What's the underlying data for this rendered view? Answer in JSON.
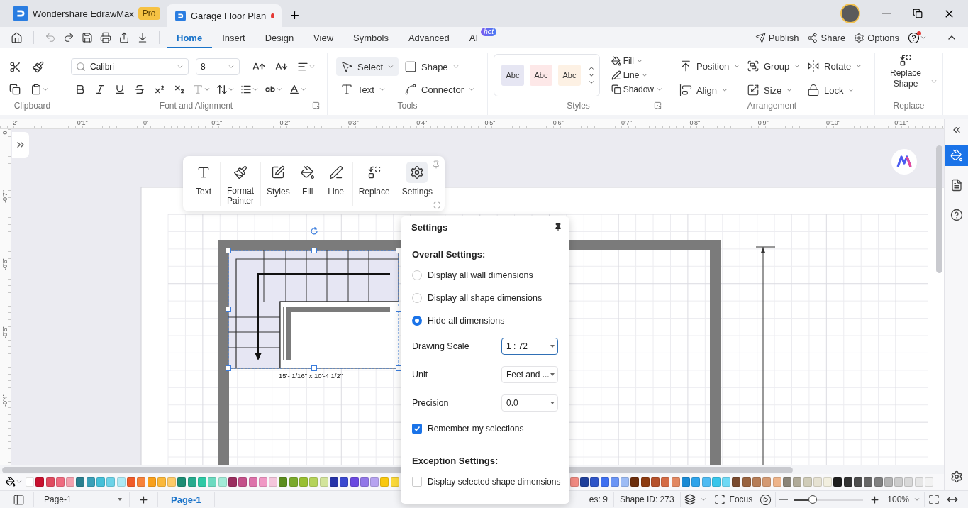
{
  "app_tab": {
    "name": "Wondershare EdrawMax",
    "badge": "Pro"
  },
  "doc_tab": {
    "title": "Garage Floor Plan",
    "unsaved": true,
    "selected": true
  },
  "quick_access": [
    {
      "kind": "undo",
      "disabled": true
    },
    {
      "kind": "redo",
      "disabled": false
    },
    {
      "kind": "save",
      "disabled": false
    },
    {
      "kind": "print",
      "disabled": false
    },
    {
      "kind": "export",
      "disabled": false
    },
    {
      "kind": "more",
      "disabled": false
    }
  ],
  "menu_tabs": [
    {
      "label": "Home",
      "selected": true
    },
    {
      "label": "Insert",
      "selected": false
    },
    {
      "label": "Design",
      "selected": false
    },
    {
      "label": "View",
      "selected": false
    },
    {
      "label": "Symbols",
      "selected": false
    },
    {
      "label": "Advanced",
      "selected": false
    },
    {
      "label": "AI",
      "selected": false,
      "badge": "hot"
    }
  ],
  "menu_actions": [
    {
      "kind": "publish",
      "label": "Publish"
    },
    {
      "kind": "share",
      "label": "Share"
    },
    {
      "kind": "options",
      "label": "Options"
    }
  ],
  "ribbon": {
    "clipboard": {
      "title": "Clipboard"
    },
    "font": {
      "title": "Font and Alignment",
      "family": "Calibri",
      "size": "8",
      "format_buttons": [
        {
          "kind": "bold",
          "disabled": false
        },
        {
          "kind": "italic",
          "disabled": false
        },
        {
          "kind": "underline",
          "disabled": false
        },
        {
          "kind": "strike",
          "disabled": false
        },
        {
          "kind": "superscript",
          "disabled": false
        },
        {
          "kind": "subscript",
          "disabled": false
        },
        {
          "kind": "text-effect",
          "disabled": true
        },
        {
          "kind": "spacing",
          "disabled": false
        },
        {
          "kind": "list",
          "disabled": false
        },
        {
          "kind": "case",
          "disabled": false
        },
        {
          "kind": "font-color",
          "disabled": false
        }
      ]
    },
    "tools": {
      "title": "Tools",
      "items": [
        {
          "kind": "select",
          "label": "Select",
          "selected": true
        },
        {
          "kind": "shape",
          "label": "Shape",
          "selected": false
        },
        {
          "kind": "text",
          "label": "Text",
          "selected": false
        },
        {
          "kind": "connector",
          "label": "Connector",
          "selected": false
        }
      ]
    },
    "styles": {
      "title": "Styles",
      "swatches": [
        {
          "label": "Abc",
          "color": "#e6e6f3"
        },
        {
          "label": "Abc",
          "color": "#fde8e8"
        },
        {
          "label": "Abc",
          "color": "#fdf1e4"
        }
      ],
      "items": [
        {
          "kind": "fill",
          "label": "Fill"
        },
        {
          "kind": "line",
          "label": "Line"
        },
        {
          "kind": "shadow",
          "label": "Shadow"
        }
      ]
    },
    "arrangement": {
      "title": "Arrangement",
      "items": [
        {
          "kind": "position",
          "label": "Position"
        },
        {
          "kind": "group",
          "label": "Group"
        },
        {
          "kind": "rotate",
          "label": "Rotate"
        },
        {
          "kind": "align",
          "label": "Align"
        },
        {
          "kind": "size",
          "label": "Size"
        },
        {
          "kind": "lock",
          "label": "Lock"
        }
      ]
    },
    "replace": {
      "title": "Replace",
      "label": "Replace Shape"
    }
  },
  "ruler": {
    "horizontal": [
      "2\"",
      "-0'1\"",
      "0'",
      "0'1\"",
      "0'2\"",
      "0'3\"",
      "0'4\"",
      "0'5\"",
      "0'6\"",
      "0'7\"",
      "0'8\"",
      "0'9\"",
      "0'10\"",
      "0'11\""
    ],
    "vertical": [
      "0",
      "-0'7\"",
      "-0'6\"",
      "-0'5\"",
      "-0'4\""
    ]
  },
  "floating_toolbar": {
    "groups": [
      {
        "items": [
          {
            "kind": "text",
            "label": "Text",
            "selected": false
          }
        ]
      },
      {
        "items": [
          {
            "kind": "painter",
            "label": "Format Painter",
            "selected": false
          }
        ]
      },
      {
        "items": [
          {
            "kind": "styles",
            "label": "Styles",
            "selected": false
          },
          {
            "kind": "fill",
            "label": "Fill",
            "selected": false
          },
          {
            "kind": "line",
            "label": "Line",
            "selected": false
          }
        ]
      },
      {
        "items": [
          {
            "kind": "replace",
            "label": "Replace",
            "selected": false
          }
        ]
      },
      {
        "items": [
          {
            "kind": "settings",
            "label": "Settings",
            "selected": true
          }
        ]
      }
    ]
  },
  "drawing": {
    "dimension_label": "15'- 1/16\" x 10'-4 1/2\""
  },
  "settings_panel": {
    "title": "Settings",
    "overall_heading": "Overall Settings:",
    "options": [
      {
        "label": "Display all wall dimensions",
        "selected": false
      },
      {
        "label": "Display all shape dimensions",
        "selected": false
      },
      {
        "label": "Hide all dimensions",
        "selected": true
      }
    ],
    "fields": [
      {
        "label": "Drawing Scale",
        "value": "1 : 72",
        "focused": true
      },
      {
        "label": "Unit",
        "value": "Feet and ...",
        "focused": false
      },
      {
        "label": "Precision",
        "value": "0.0",
        "focused": false
      }
    ],
    "remember": {
      "label": "Remember my selections",
      "checked": true
    },
    "exception_heading": "Exception Settings:",
    "exception": {
      "label": "Display selected shape dimensions",
      "checked": false
    }
  },
  "palette_left": [
    {
      "color": "#ffffff"
    },
    {
      "color": "#c8102e"
    },
    {
      "color": "#e04a5f"
    },
    {
      "color": "#ef6b80"
    },
    {
      "color": "#f3a0ae"
    },
    {
      "color": "#2a7f8f"
    },
    {
      "color": "#3aa0b8"
    },
    {
      "color": "#45c0d8"
    },
    {
      "color": "#6dd3e8"
    },
    {
      "color": "#aeeaf5"
    },
    {
      "color": "#f05a28"
    },
    {
      "color": "#f7823a"
    },
    {
      "color": "#f9a01b"
    },
    {
      "color": "#fbb83a"
    },
    {
      "color": "#fdca68"
    },
    {
      "color": "#1c8c74"
    },
    {
      "color": "#27ab8e"
    },
    {
      "color": "#2ec9a5"
    },
    {
      "color": "#6cdac0"
    },
    {
      "color": "#a3ebd8"
    },
    {
      "color": "#9a2d5f"
    },
    {
      "color": "#c4508a"
    },
    {
      "color": "#dd72aa"
    },
    {
      "color": "#f097c4"
    },
    {
      "color": "#f4c6dc"
    },
    {
      "color": "#5b8c1e"
    },
    {
      "color": "#7aaa2c"
    },
    {
      "color": "#98bf31"
    },
    {
      "color": "#b5d35a"
    },
    {
      "color": "#d3e49b"
    },
    {
      "color": "#2633a8"
    },
    {
      "color": "#3a48d0"
    },
    {
      "color": "#6a49e0"
    },
    {
      "color": "#9177e8"
    },
    {
      "color": "#b6a3f0"
    },
    {
      "color": "#f9c80e"
    },
    {
      "color": "#fbd93b"
    }
  ],
  "palette_right": [
    {
      "color": "#f28b82"
    },
    {
      "color": "#1f3f9a"
    },
    {
      "color": "#2f55c8"
    },
    {
      "color": "#3e6ff0"
    },
    {
      "color": "#6b95f5"
    },
    {
      "color": "#9dbcf5"
    },
    {
      "color": "#6b2d0c"
    },
    {
      "color": "#8c3a0f"
    },
    {
      "color": "#b5502a"
    },
    {
      "color": "#d46b45"
    },
    {
      "color": "#e28862"
    },
    {
      "color": "#1a8ad4"
    },
    {
      "color": "#2ea3ea"
    },
    {
      "color": "#4fbbf2"
    },
    {
      "color": "#38c5ea"
    },
    {
      "color": "#6ed9f5"
    },
    {
      "color": "#7a4a2e"
    },
    {
      "color": "#9a6440"
    },
    {
      "color": "#b67d57"
    },
    {
      "color": "#d49a73"
    },
    {
      "color": "#eeb48a"
    },
    {
      "color": "#8a8478"
    },
    {
      "color": "#b0aa98"
    },
    {
      "color": "#d0ccb8"
    },
    {
      "color": "#e6e2d2"
    },
    {
      "color": "#f2efdf"
    },
    {
      "color": "#1e1e1e"
    },
    {
      "color": "#333333"
    },
    {
      "color": "#4d4d4d"
    },
    {
      "color": "#666666"
    },
    {
      "color": "#808080"
    },
    {
      "color": "#b3b3b3"
    },
    {
      "color": "#cccccc"
    },
    {
      "color": "#d9d9d9"
    },
    {
      "color": "#e6e6e6"
    },
    {
      "color": "#f2f2f2"
    }
  ],
  "right_panel": [
    {
      "kind": "format",
      "selected": true
    },
    {
      "kind": "page",
      "selected": false
    },
    {
      "kind": "help",
      "selected": false
    }
  ],
  "status_bar": {
    "page_select": "Page-1",
    "page_tab": "Page-1",
    "shapes": "es: 9",
    "shape_id": "Shape ID: 273",
    "focus": "Focus",
    "zoom": "100%",
    "zoom_slider": {
      "level": 0.26
    }
  }
}
